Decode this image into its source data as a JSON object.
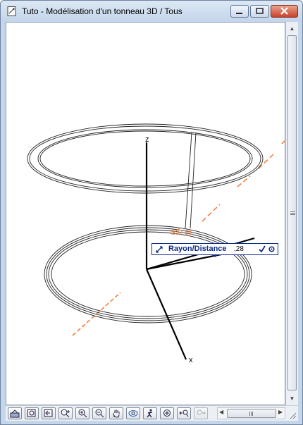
{
  "window": {
    "title": "Tuto - Modélisation d'un tonneau 3D / Tous"
  },
  "viewport": {
    "axes": {
      "z": "z",
      "x": "x"
    },
    "dimension_text": "137.91"
  },
  "tracker": {
    "label": "Rayon/Distance",
    "value": ",28",
    "confirm_icon": "check-icon",
    "options_icon": "gear-icon"
  },
  "toolbar": {
    "buttons": [
      "fit-in-window-icon",
      "zoom-window-icon",
      "previous-view-icon",
      "zoom-extents-icon",
      "zoom-in-icon",
      "zoom-out-icon",
      "pan-icon",
      "orbit-icon",
      "walk-icon",
      "zoom-center-icon",
      "previous-zoom-icon",
      "next-zoom-icon"
    ]
  },
  "colors": {
    "window_frame": "#c4d6ea",
    "close_button": "#c8422a",
    "construction_line": "#f08040",
    "tracker_border": "#0b2a8a"
  }
}
